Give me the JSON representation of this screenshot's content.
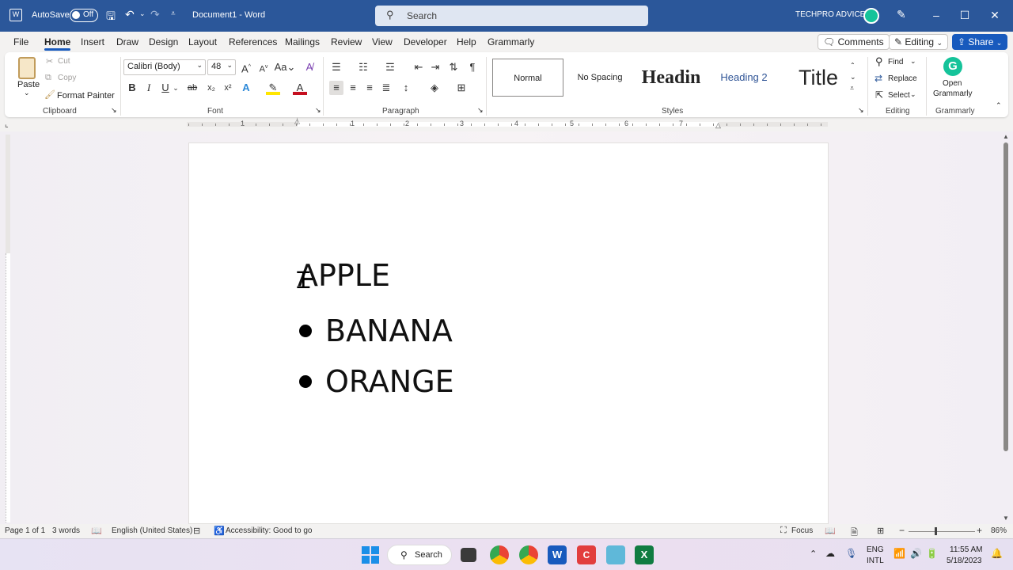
{
  "titlebar": {
    "autosave": "AutoSave",
    "autosave_state": "Off",
    "doc_title": "Document1  -  Word",
    "search": "Search",
    "user": "TECHPRO ADVICE",
    "minimize": "–",
    "maximize": "☐",
    "close": "✕"
  },
  "tabs": [
    "File",
    "Home",
    "Insert",
    "Draw",
    "Design",
    "Layout",
    "References",
    "Mailings",
    "Review",
    "View",
    "Developer",
    "Help",
    "Grammarly"
  ],
  "tab_active": "Home",
  "tab_buttons": {
    "comments": "Comments",
    "editing": "Editing",
    "share": "Share"
  },
  "clipboard": {
    "paste": "Paste",
    "cut": "Cut",
    "copy": "Copy",
    "format_painter": "Format Painter",
    "label": "Clipboard"
  },
  "font": {
    "name": "Calibri (Body)",
    "size": "48",
    "label": "Font"
  },
  "paragraph": {
    "label": "Paragraph"
  },
  "styles": {
    "items": [
      "Normal",
      "No Spacing",
      "Headin",
      "Heading 2",
      "Title"
    ],
    "label": "Styles"
  },
  "editing": {
    "find": "Find",
    "replace": "Replace",
    "select": "Select",
    "label": "Editing"
  },
  "grammarly": {
    "open": "Open",
    "open2": "Grammarly",
    "label": "Grammarly"
  },
  "ruler_numbers": [
    "1",
    "1",
    "2",
    "3",
    "4",
    "5",
    "6",
    "7"
  ],
  "document": {
    "line1": "APPLE",
    "bullets": [
      "BANANA",
      "ORANGE"
    ]
  },
  "status": {
    "page": "Page 1 of 1",
    "words": "3 words",
    "language": "English (United States)",
    "accessibility": "Accessibility: Good to go",
    "focus": "Focus",
    "zoom": "86%"
  },
  "taskbar": {
    "search": "Search",
    "lang1": "ENG",
    "lang2": "INTL",
    "time": "11:55 AM",
    "date": "5/18/2023"
  },
  "colors": {
    "titlebar": "#2b579a",
    "accent": "#185abd",
    "grammarly": "#15c39a",
    "excel": "#107c41",
    "word": "#185abd"
  }
}
